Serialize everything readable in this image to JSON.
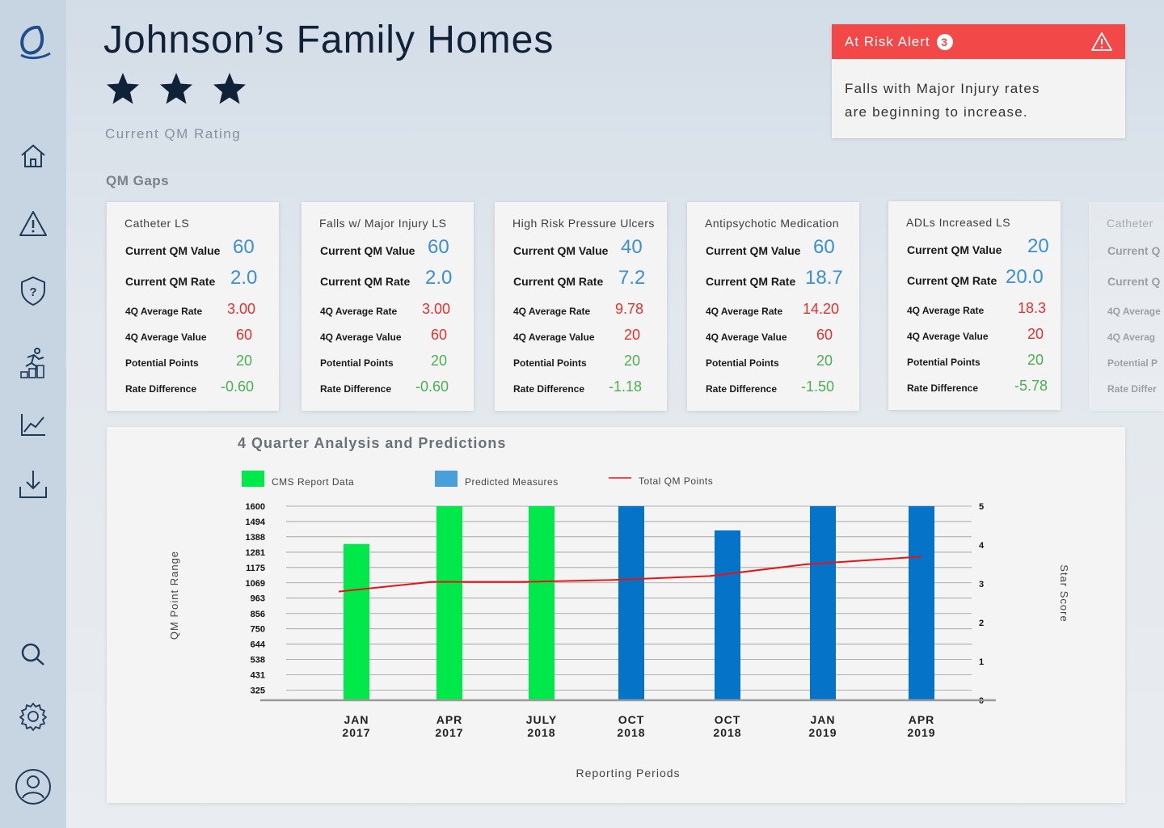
{
  "header": {
    "title": "Johnson’s Family Homes",
    "rating_label": "Current QM Rating",
    "stars_filled": 3
  },
  "sections": {
    "qm_gaps_label": "QM Gaps"
  },
  "alert": {
    "title": "At Risk Alert",
    "count": "3",
    "message_line1": "Falls with Major Injury rates",
    "message_line2": "are beginning to increase.",
    "color": "#f24848"
  },
  "sidebar": {
    "icons": [
      "logo-icon",
      "home-icon",
      "alert-icon",
      "shield-question-icon",
      "activity-icon",
      "line-chart-icon",
      "download-icon",
      "search-icon",
      "gear-icon",
      "user-icon"
    ]
  },
  "card_labels": {
    "current_value": "Current QM Value",
    "current_rate": "Current QM Rate",
    "avg_rate": "4Q Average Rate",
    "avg_value": "4Q Average Value",
    "potential": "Potential Points",
    "rate_diff": "Rate Difference"
  },
  "faded_card_labels": {
    "title": "Catheter",
    "current_value": "Current Q",
    "current_rate": "Current Q",
    "avg_rate": "4Q Average",
    "avg_value": "4Q Averag",
    "potential": "Potential P",
    "rate_diff": "Rate Differ"
  },
  "cards": [
    {
      "title": "Catheter LS",
      "current_value": "60",
      "current_rate": "2.0",
      "avg_rate": "3.00",
      "avg_value": "60",
      "potential": "20",
      "rate_diff": "-0.60"
    },
    {
      "title": "Falls w/ Major Injury LS",
      "current_value": "60",
      "current_rate": "2.0",
      "avg_rate": "3.00",
      "avg_value": "60",
      "potential": "20",
      "rate_diff": "-0.60"
    },
    {
      "title": "High Risk Pressure Ulcers",
      "current_value": "40",
      "current_rate": "7.2",
      "avg_rate": "9.78",
      "avg_value": "20",
      "potential": "20",
      "rate_diff": "-1.18"
    },
    {
      "title": "Antipsychotic Medication",
      "current_value": "60",
      "current_rate": "18.7",
      "avg_rate": "14.20",
      "avg_value": "60",
      "potential": "20",
      "rate_diff": "-1.50"
    },
    {
      "title": "ADLs Increased LS",
      "current_value": "20",
      "current_rate": "20.0",
      "avg_rate": "18.3",
      "avg_value": "20",
      "potential": "20",
      "rate_diff": "-5.78"
    }
  ],
  "chart_data": {
    "type": "bar",
    "title": "4 Quarter Analysis and Predictions",
    "xlabel": "Reporting Periods",
    "ylabel": "QM Point Range",
    "y2label": "Star Score",
    "legend": [
      {
        "name": "CMS Report Data",
        "kind": "bar",
        "color": "#00e84a"
      },
      {
        "name": "Predicted Measures",
        "kind": "bar",
        "color": "#4a9fd8"
      },
      {
        "name": "Total QM Points",
        "kind": "line",
        "color": "#e81414"
      }
    ],
    "categories": [
      [
        "JAN",
        "2017"
      ],
      [
        "APR",
        "2017"
      ],
      [
        "JULY",
        "2018"
      ],
      [
        "OCT",
        "2018"
      ],
      [
        "OCT",
        "2018"
      ],
      [
        "JAN",
        "2019"
      ],
      [
        "APR",
        "2019"
      ]
    ],
    "y_ticks": [
      325,
      431,
      538,
      644,
      750,
      856,
      963,
      1069,
      1175,
      1281,
      1388,
      1494,
      1600
    ],
    "y2_ticks": [
      0,
      1,
      2,
      3,
      4,
      5
    ],
    "ylim": [
      255,
      1600
    ],
    "y2lim": [
      0,
      5
    ],
    "bar_values": [
      1338,
      1600,
      1600,
      1600,
      1432,
      1600,
      1600
    ],
    "bar_kind": [
      "cms",
      "cms",
      "cms",
      "predicted",
      "predicted",
      "predicted",
      "predicted"
    ],
    "cms_bar_color": "#00e84a",
    "predicted_bar_color": "#0574c8",
    "line_star_values": [
      2.8,
      3.05,
      3.05,
      3.1,
      3.2,
      3.5,
      3.7
    ]
  }
}
